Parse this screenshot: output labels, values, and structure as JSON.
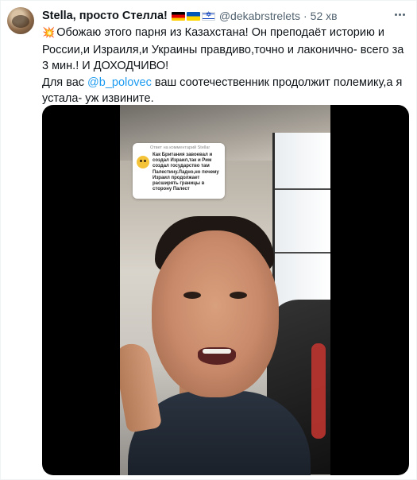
{
  "tweet": {
    "author_name": "Stella, просто Стелла!",
    "flags": [
      "flag-germany-icon",
      "flag-ukraine-icon",
      "flag-israel-icon"
    ],
    "handle": "@dekabrstrelets",
    "separator": "·",
    "timestamp": "52 хв",
    "more_icon": "more-horizontal-icon",
    "body": {
      "line1_emoji": "💥",
      "line1": "Обожаю этого парня из Казахстана! Он преподаёт  историю и России,и Израиля,и Украины правдиво,точно и лаконично- всего за 3 мин.! И ДОХОДЧИВО!",
      "line2_prefix": "Для вас ",
      "mention": "@b_polovec",
      "line2_suffix": " ваш соотечественник продолжит полемику,а я устала- уж извините."
    }
  },
  "video": {
    "comment_header": "Ответ  на комментарий Stellar",
    "comment_text": "Как Британия завоевал и создал Израил,так и Рим создал государство там Палестину.Ладно,но почему Израил продолжает расширять границы в сторону Палест"
  },
  "colors": {
    "link": "#1d9bf0",
    "text": "#0f1419",
    "secondary": "#536471",
    "media_bg": "#000000"
  }
}
